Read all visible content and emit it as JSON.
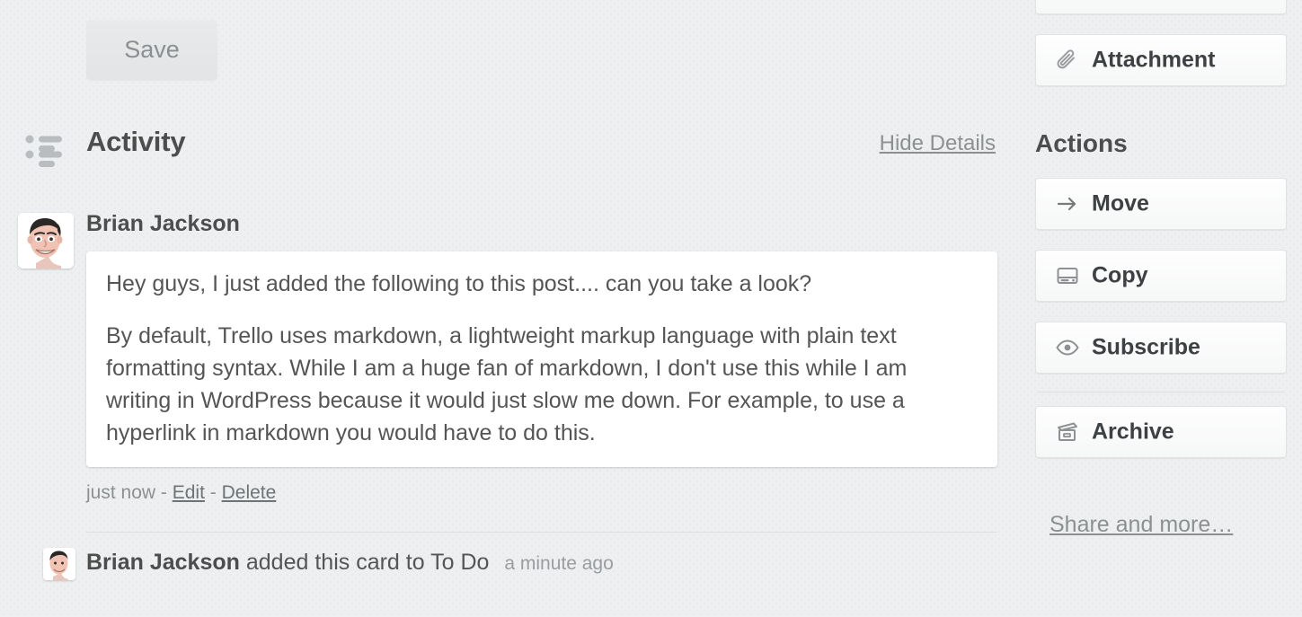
{
  "colors": {
    "background": "#edeff0",
    "card_surface": "#ffffff",
    "text_primary": "#4d4d4d",
    "text_secondary": "#8d9091",
    "button_face": "#f7f8f8",
    "divider": "#dcdfe0"
  },
  "main": {
    "save_label": "Save",
    "activity_title": "Activity",
    "hide_details_label": "Hide Details",
    "comment": {
      "author": "Brian Jackson",
      "paragraphs": [
        "Hey guys, I just added the following to this post.... can you take a look?",
        "By default, Trello uses markdown, a lightweight markup language with plain text formatting syntax. While I am a huge fan of markdown, I don't use this while I am writing in WordPress because it would just slow me down. For example, to use a hyperlink in markdown you would have to do this."
      ],
      "timestamp": "just now",
      "separator": "-",
      "edit_label": "Edit",
      "delete_label": "Delete"
    },
    "activity_entry": {
      "author": "Brian Jackson",
      "action": "added this card to To Do",
      "time": "a minute ago"
    }
  },
  "sidebar": {
    "attachment_label": "Attachment",
    "actions_title": "Actions",
    "move_label": "Move",
    "copy_label": "Copy",
    "subscribe_label": "Subscribe",
    "archive_label": "Archive",
    "share_label": "Share and more…"
  }
}
